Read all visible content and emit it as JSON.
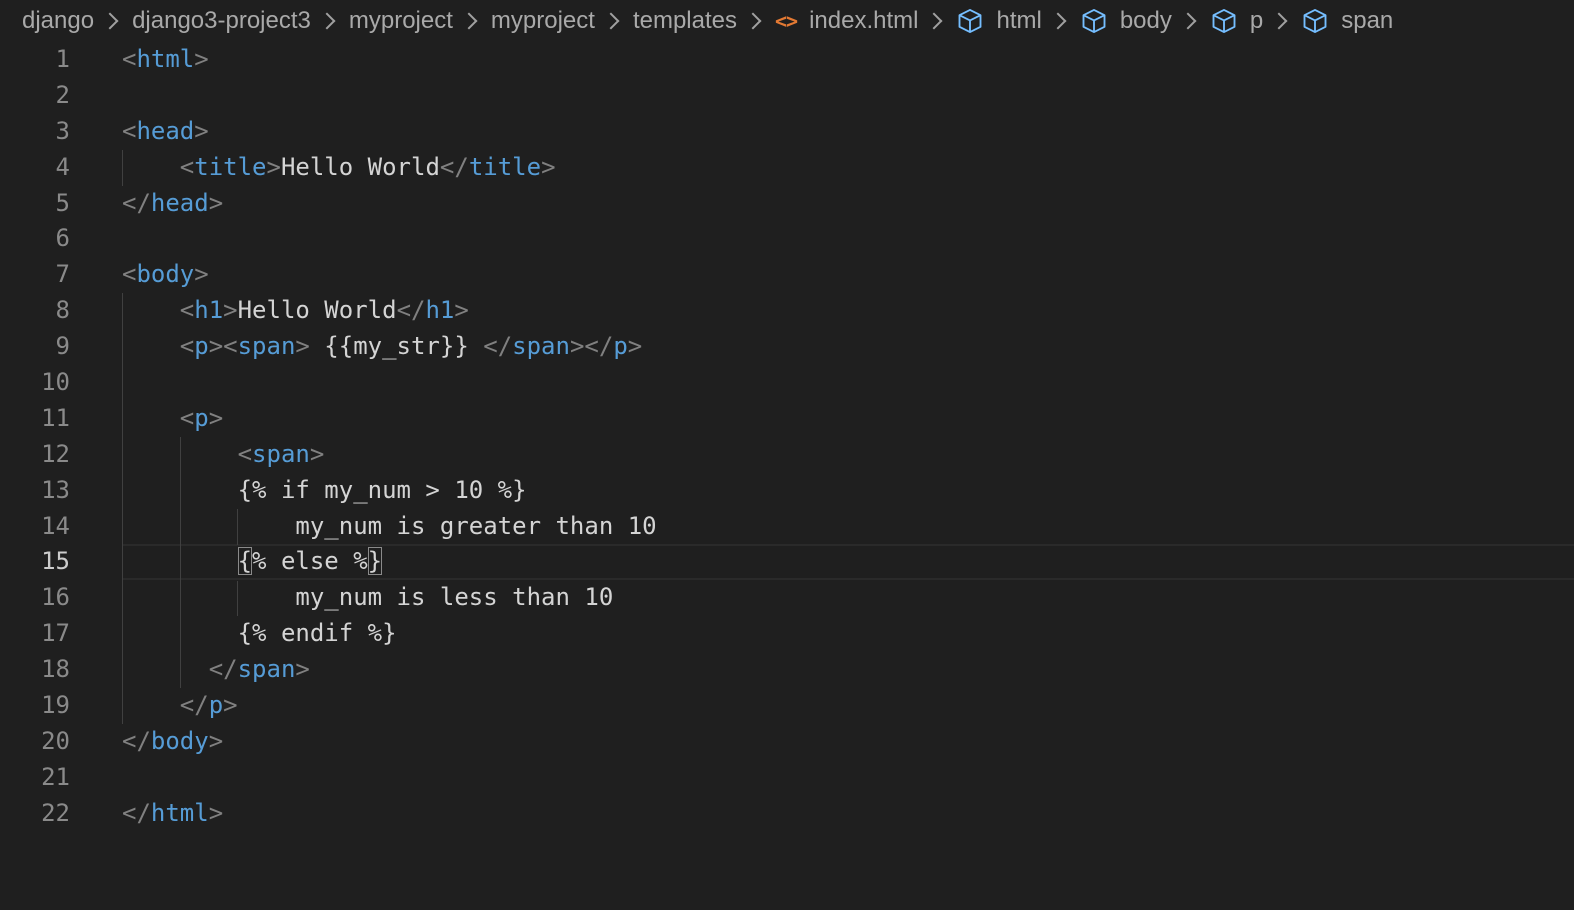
{
  "breadcrumb": {
    "items": [
      {
        "label": "django"
      },
      {
        "label": "django3-project3"
      },
      {
        "label": "myproject"
      },
      {
        "label": "myproject"
      },
      {
        "label": "templates"
      },
      {
        "label": "index.html",
        "icon": "html-file-icon",
        "icon_glyph": "<>"
      },
      {
        "label": "html",
        "icon": "cube-icon"
      },
      {
        "label": "body",
        "icon": "cube-icon"
      },
      {
        "label": "p",
        "icon": "cube-icon"
      },
      {
        "label": "span",
        "icon": "cube-icon"
      }
    ]
  },
  "colors": {
    "background": "#1f1f1f",
    "tag_name": "#569cd6",
    "tag_bracket": "#808080",
    "text": "#d4d4d4",
    "line_number": "#8a8a8a",
    "html_icon": "#e37933",
    "symbol_icon": "#75beff"
  },
  "editor": {
    "current_line": 15,
    "lines": [
      {
        "n": "1",
        "code": "<html>"
      },
      {
        "n": "2",
        "code": ""
      },
      {
        "n": "3",
        "code": "<head>"
      },
      {
        "n": "4",
        "code": "    <title>Hello World</title>"
      },
      {
        "n": "5",
        "code": "</head>"
      },
      {
        "n": "6",
        "code": ""
      },
      {
        "n": "7",
        "code": "<body>"
      },
      {
        "n": "8",
        "code": "    <h1>Hello World</h1>"
      },
      {
        "n": "9",
        "code": "    <p><span> {{my_str}} </span></p>"
      },
      {
        "n": "10",
        "code": ""
      },
      {
        "n": "11",
        "code": "    <p>"
      },
      {
        "n": "12",
        "code": "        <span>"
      },
      {
        "n": "13",
        "code": "        {% if my_num > 10 %}"
      },
      {
        "n": "14",
        "code": "            my_num is greater than 10"
      },
      {
        "n": "15",
        "code": "        {% else %}"
      },
      {
        "n": "16",
        "code": "            my_num is less than 10"
      },
      {
        "n": "17",
        "code": "        {% endif %}"
      },
      {
        "n": "18",
        "code": "      </span>"
      },
      {
        "n": "19",
        "code": "    </p>"
      },
      {
        "n": "20",
        "code": "</body>"
      },
      {
        "n": "21",
        "code": ""
      },
      {
        "n": "22",
        "code": "</html>"
      }
    ]
  }
}
